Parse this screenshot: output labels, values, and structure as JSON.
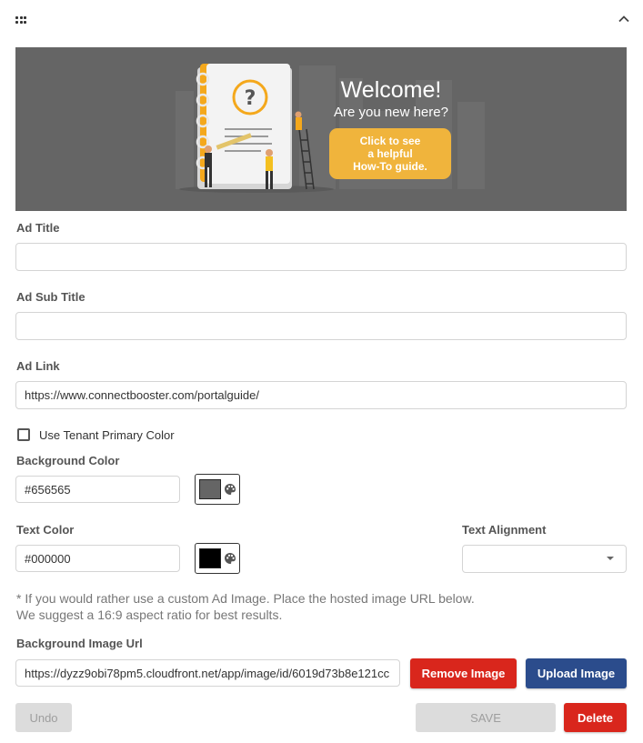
{
  "header": {
    "drag_icon": "grid-dots-icon",
    "collapse_icon": "chevron-up-icon"
  },
  "banner": {
    "background_color": "#656565",
    "headline": "Welcome!",
    "subline": "Are you new here?",
    "cta_lines": [
      "Click to see",
      "a helpful",
      "How-To guide."
    ],
    "cta_color": "#f0b43c"
  },
  "ad_title": {
    "label": "Ad Title",
    "value": ""
  },
  "ad_sub_title": {
    "label": "Ad Sub Title",
    "value": ""
  },
  "ad_link": {
    "label": "Ad Link",
    "value": "https://www.connectbooster.com/portalguide/"
  },
  "use_tenant_color": {
    "label": "Use Tenant Primary Color",
    "checked": false
  },
  "background_color": {
    "label": "Background Color",
    "value": "#656565",
    "swatch": "#656565",
    "icon": "palette-icon"
  },
  "text_color": {
    "label": "Text Color",
    "value": "#000000",
    "swatch": "#000000",
    "icon": "palette-icon"
  },
  "text_alignment": {
    "label": "Text Alignment",
    "value": ""
  },
  "note": {
    "line1": "* If you would rather use a custom Ad Image. Place the hosted image URL below.",
    "line2": "We suggest a 16:9 aspect ratio for best results."
  },
  "background_image": {
    "label": "Background Image Url",
    "value": "https://dyzz9obi78pm5.cloudfront.net/app/image/id/6019d73b8e121cc"
  },
  "buttons": {
    "remove_image": "Remove Image",
    "upload_image": "Upload Image",
    "undo": "Undo",
    "save": "SAVE",
    "delete": "Delete"
  },
  "colors": {
    "danger": "#d9261c",
    "primary": "#2b4c8c",
    "disabled": "#dcdcdc"
  }
}
